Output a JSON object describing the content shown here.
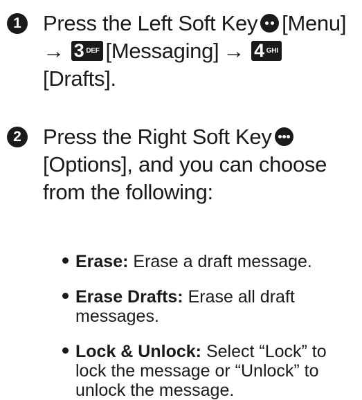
{
  "step1": {
    "number": "1",
    "line1_prefix": "Press the Left Soft Key",
    "line1_suffix": "[Menu]",
    "arrow": "→",
    "key1_digit": "3",
    "key1_letters": "DEF",
    "line2_mid": "[Messaging]",
    "key2_digit": "4",
    "key2_letters": "GHI",
    "line3": "[Drafts]."
  },
  "step2": {
    "number": "2",
    "line1_prefix": "Press the Right Soft Key",
    "line2": "[Options], and you can choose",
    "line3": "from the following:"
  },
  "options": [
    {
      "term": "Erase:",
      "lines": [
        "Erase a draft message."
      ]
    },
    {
      "term": "Erase Drafts:",
      "lines": [
        "Erase all draft",
        "messages."
      ]
    },
    {
      "term": "Lock & Unlock:",
      "lines": [
        "Select “Lock” to",
        "lock the message or “Unlock” to",
        "unlock the message."
      ]
    }
  ],
  "icons": {
    "left_softkey": "left-softkey-icon",
    "right_softkey": "right-softkey-icon",
    "bullet": "bullet-dot"
  },
  "colors": {
    "text": "#1a1a1a",
    "background": "#ffffff"
  }
}
